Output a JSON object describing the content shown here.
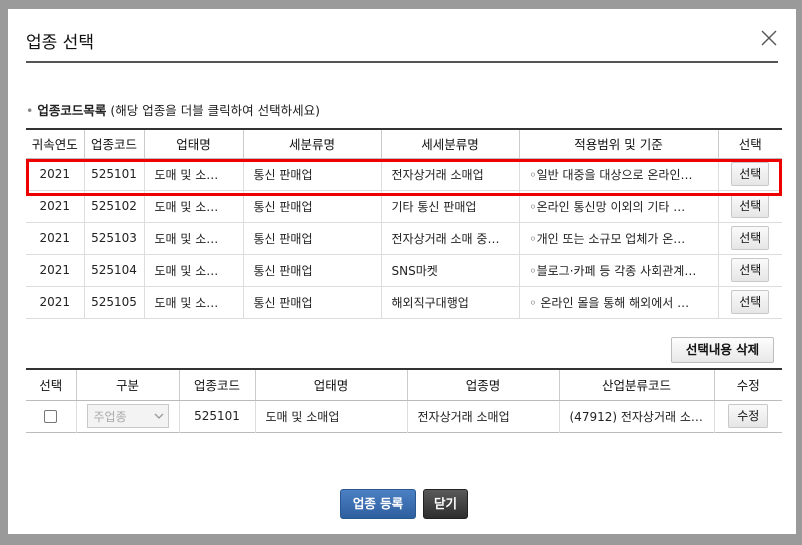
{
  "modal": {
    "title": "업종 선택"
  },
  "code_list": {
    "label": "업종코드목록",
    "hint": "(해당 업종을 더블 클릭하여 선택하세요)",
    "headers": [
      "귀속연도",
      "업종코드",
      "업태명",
      "세분류명",
      "세세분류명",
      "적용범위 및 기준",
      "선택"
    ],
    "rows": [
      {
        "year": "2021",
        "code": "525101",
        "business": "도매 및 소…",
        "sub": "통신 판매업",
        "subsub": "전자상거래 소매업",
        "scope": "◦일반 대중을 대상으로 온라인…",
        "select": "선택"
      },
      {
        "year": "2021",
        "code": "525102",
        "business": "도매 및 소…",
        "sub": "통신 판매업",
        "subsub": "기타 통신 판매업",
        "scope": "◦온라인 통신망 이외의 기타 …",
        "select": "선택"
      },
      {
        "year": "2021",
        "code": "525103",
        "business": "도매 및 소…",
        "sub": "통신 판매업",
        "subsub": "전자상거래 소매 중…",
        "scope": "◦개인 또는 소규모 업체가 온…",
        "select": "선택"
      },
      {
        "year": "2021",
        "code": "525104",
        "business": "도매 및 소…",
        "sub": "통신 판매업",
        "subsub": "SNS마켓",
        "scope": "◦블로그·카페 등 각종 사회관계…",
        "select": "선택"
      },
      {
        "year": "2021",
        "code": "525105",
        "business": "도매 및 소…",
        "sub": "통신 판매업",
        "subsub": "해외직구대행업",
        "scope": "◦ 온라인 몰을 통해 해외에서 …",
        "select": "선택"
      }
    ]
  },
  "delete_button": "선택내용 삭제",
  "selected": {
    "headers": [
      "선택",
      "구분",
      "업종코드",
      "업태명",
      "업종명",
      "산업분류코드",
      "수정"
    ],
    "rows": [
      {
        "type": "주업종",
        "code": "525101",
        "business": "도매 및 소매업",
        "name": "전자상거래 소매업",
        "industry": "(47912) 전자상거래 소…",
        "edit": "수정"
      }
    ]
  },
  "footer": {
    "register": "업종 등록",
    "close": "닫기"
  },
  "colors": {
    "primary": "#3a6db2",
    "dark": "#3a3a3a",
    "highlight": "#e00000"
  }
}
